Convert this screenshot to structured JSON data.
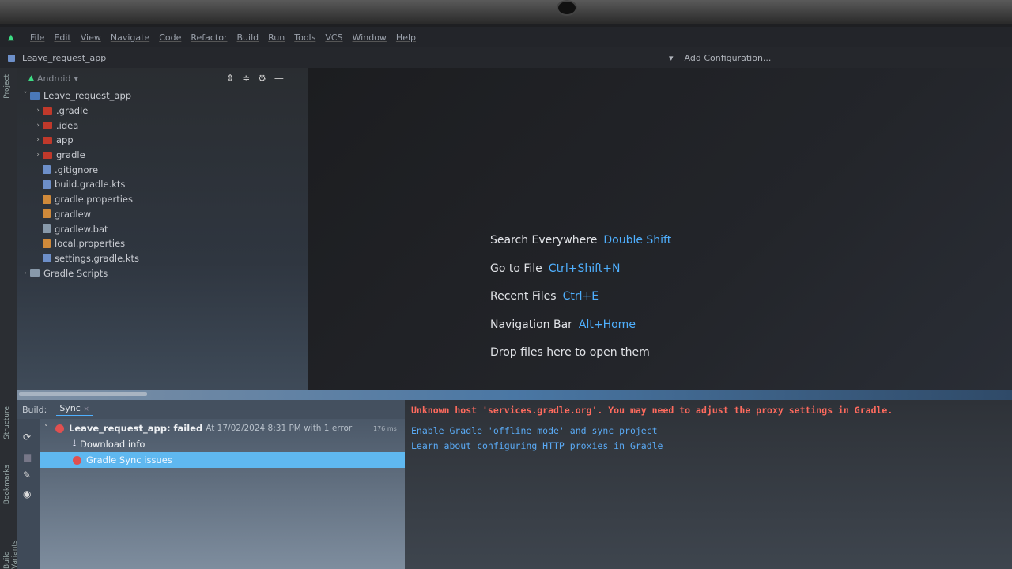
{
  "menu": [
    "File",
    "Edit",
    "View",
    "Navigate",
    "Code",
    "Refactor",
    "Build",
    "Run",
    "Tools",
    "VCS",
    "Window",
    "Help"
  ],
  "title": {
    "project": "Leave_request_app",
    "add_config": "Add Configuration..."
  },
  "stripe": {
    "project_label": "Project",
    "structure_label": "Structure",
    "bookmarks_label": "Bookmarks",
    "variants_label": "Build Variants"
  },
  "project_panel": {
    "view": "Android",
    "tree": [
      {
        "label": "Leave_request_app",
        "level": 0,
        "arrow": "˅",
        "icon": "folder-blue"
      },
      {
        "label": ".gradle",
        "level": 1,
        "arrow": "›",
        "icon": "folder"
      },
      {
        "label": ".idea",
        "level": 1,
        "arrow": "›",
        "icon": "folder"
      },
      {
        "label": "app",
        "level": 1,
        "arrow": "›",
        "icon": "folder"
      },
      {
        "label": "gradle",
        "level": 1,
        "arrow": "›",
        "icon": "folder"
      },
      {
        "label": ".gitignore",
        "level": 1,
        "arrow": "",
        "icon": "file"
      },
      {
        "label": "build.gradle.kts",
        "level": 1,
        "arrow": "",
        "icon": "file"
      },
      {
        "label": "gradle.properties",
        "level": 1,
        "arrow": "",
        "icon": "file-orange"
      },
      {
        "label": "gradlew",
        "level": 1,
        "arrow": "",
        "icon": "file-orange"
      },
      {
        "label": "gradlew.bat",
        "level": 1,
        "arrow": "",
        "icon": "file-grey"
      },
      {
        "label": "local.properties",
        "level": 1,
        "arrow": "",
        "icon": "file-orange"
      },
      {
        "label": "settings.gradle.kts",
        "level": 1,
        "arrow": "",
        "icon": "file"
      },
      {
        "label": "Gradle Scripts",
        "level": 0,
        "arrow": "›",
        "icon": "gradle"
      }
    ]
  },
  "editor_hints": [
    {
      "text": "Search Everywhere",
      "key": "Double Shift"
    },
    {
      "text": "Go to File",
      "key": "Ctrl+Shift+N"
    },
    {
      "text": "Recent Files",
      "key": "Ctrl+E"
    },
    {
      "text": "Navigation Bar",
      "key": "Alt+Home"
    },
    {
      "text": "Drop files here to open them",
      "key": ""
    }
  ],
  "build": {
    "tab_label": "Build:",
    "sync_tab": "Sync",
    "status_name": "Leave_request_app: failed",
    "status_detail": "At 17/02/2024 8:31 PM with 1 error",
    "duration": "176 ms",
    "download_info": "Download info",
    "sync_issues": "Gradle Sync issues",
    "error_message": "Unknown host 'services.gradle.org'. You may need to adjust the proxy settings in Gradle.",
    "link_offline": "Enable Gradle 'offline mode' and sync project",
    "link_proxy": "Learn about configuring HTTP proxies in Gradle"
  }
}
